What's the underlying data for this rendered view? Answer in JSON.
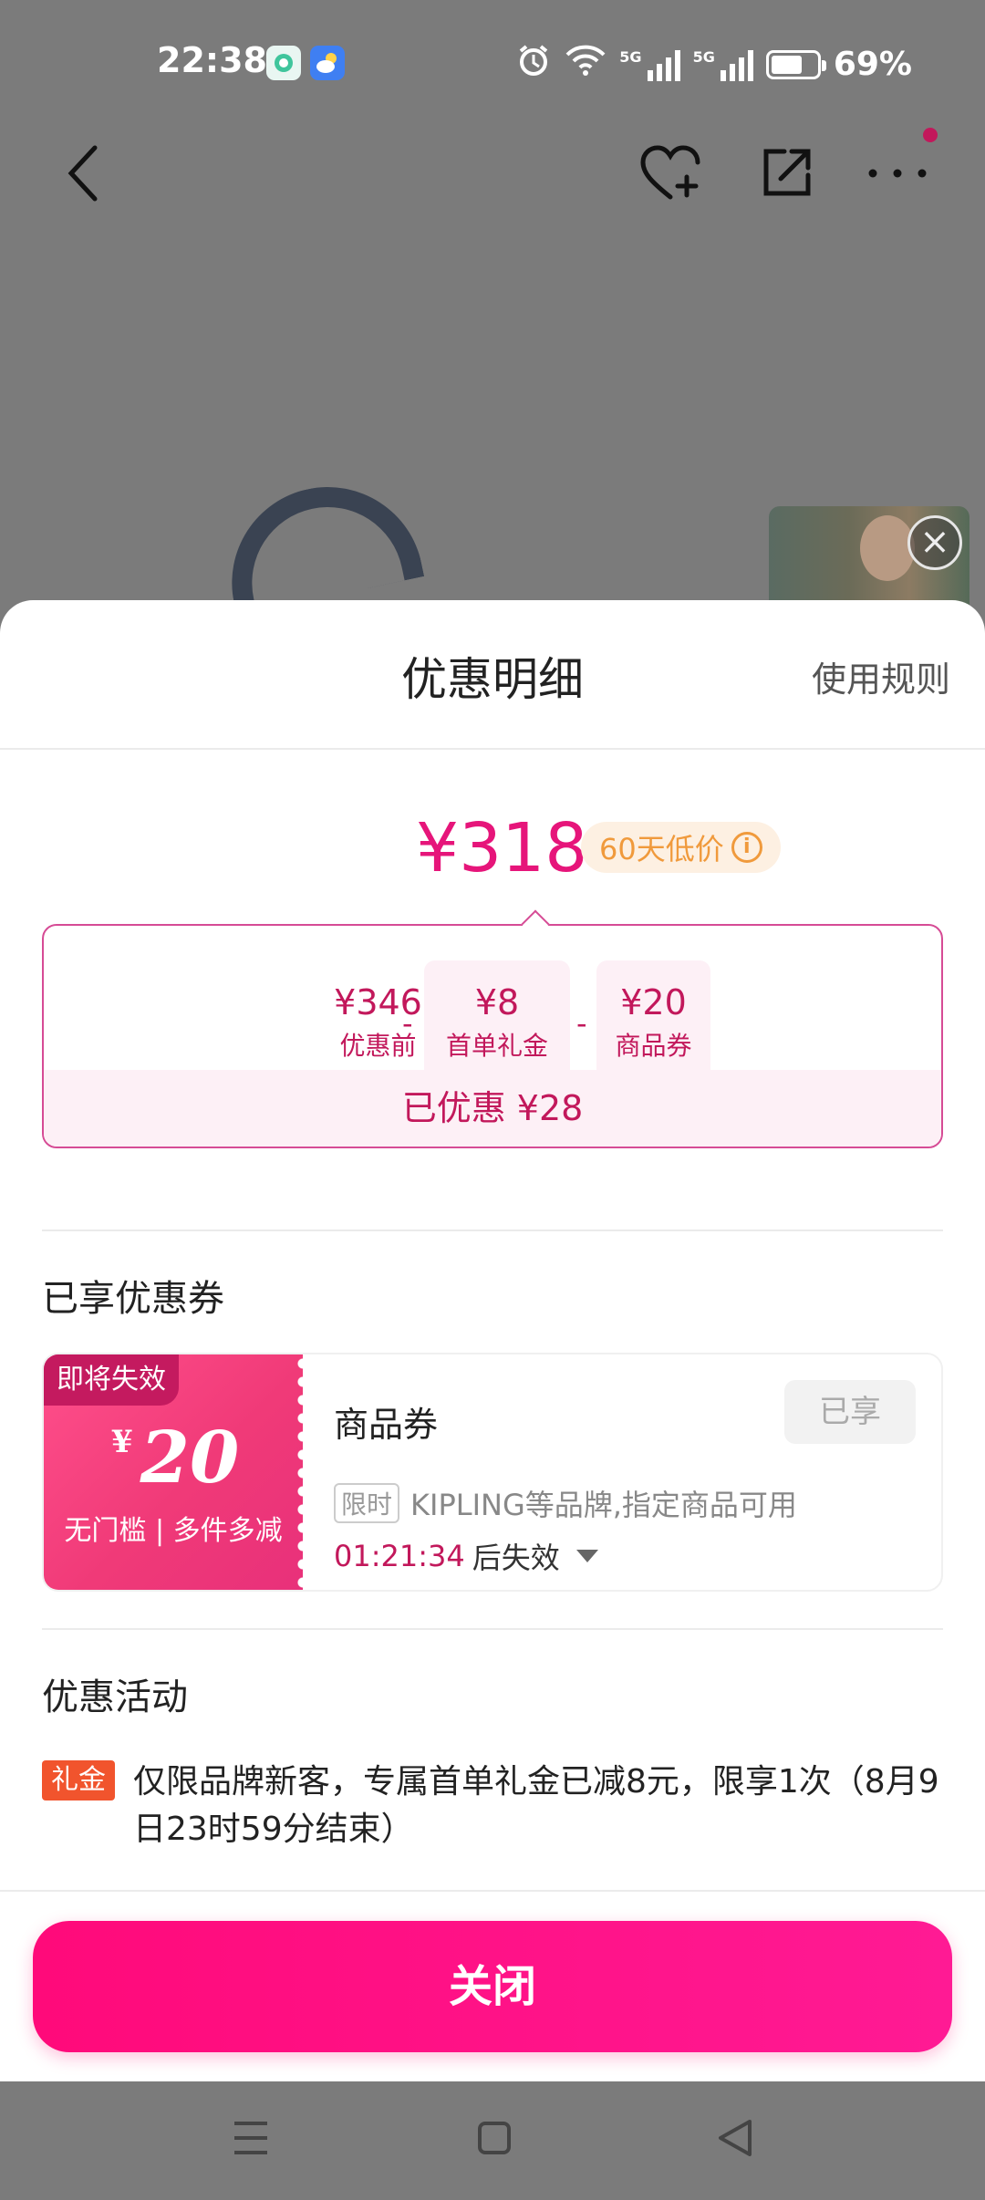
{
  "status_bar": {
    "time": "22:38",
    "battery": "69%",
    "battery_level": 0.69,
    "signal_1_label": "5G",
    "signal_2_label": "5G"
  },
  "top_nav": {
    "back_icon": "chevron-left-icon",
    "favorite_icon": "heart-plus-icon",
    "share_icon": "share-icon",
    "more_icon": "more-dots-icon"
  },
  "sheet": {
    "title": "优惠明细",
    "rules_link": "使用规则",
    "price": "¥318",
    "low_price_badge": "60天低价",
    "calc": {
      "items": [
        {
          "value": "¥346",
          "label": "优惠前"
        },
        {
          "value": "¥8",
          "label": "首单礼金"
        },
        {
          "value": "¥20",
          "label": "商品券"
        }
      ],
      "operators": [
        "-",
        "-"
      ],
      "total": "已优惠 ¥28"
    },
    "coupons_section_title": "已享优惠券",
    "coupon": {
      "expiring_tag": "即将失效",
      "currency": "¥",
      "amount": "20",
      "condition": "无门槛 | 多件多减",
      "name": "商品券",
      "status_button": "已享",
      "limit_tag": "限时",
      "scope": "KIPLING等品牌,指定商品可用",
      "countdown": "01:21:34",
      "countdown_suffix": "后失效"
    },
    "activities_section_title": "优惠活动",
    "activity": {
      "tag": "礼金",
      "text": "仅限品牌新客，专属首单礼金已减8元，限享1次（8月9日23时59分结束）"
    },
    "close_button": "关闭"
  },
  "colors": {
    "accent": "#e6157a",
    "accent_dark": "#c2185b",
    "button": "#ff0a7a",
    "activity_tag": "#f1542d",
    "badge_text": "#f09a3c"
  }
}
